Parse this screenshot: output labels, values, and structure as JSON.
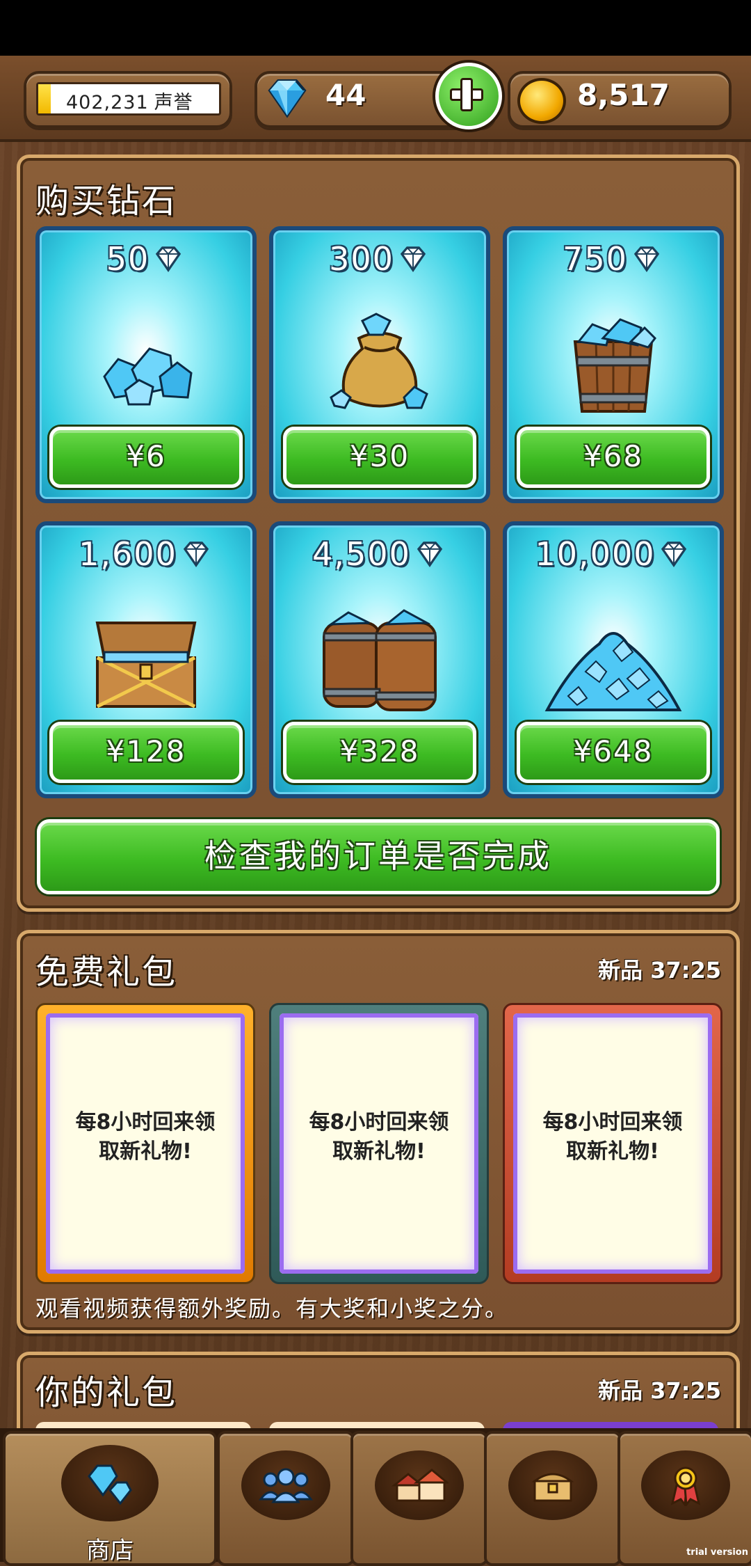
{
  "topbar": {
    "reputation": {
      "value": "402,231",
      "label": "声誉",
      "fill_fraction": 0.07
    },
    "gems": "44",
    "gold": "8,517"
  },
  "buy_gems": {
    "title": "购买钻石",
    "packs": [
      {
        "amount": "50",
        "price": "¥6",
        "art": "gem-pile-small"
      },
      {
        "amount": "300",
        "price": "¥30",
        "art": "gem-sack"
      },
      {
        "amount": "750",
        "price": "¥68",
        "art": "gem-bucket"
      },
      {
        "amount": "1,600",
        "price": "¥128",
        "art": "gem-chest"
      },
      {
        "amount": "4,500",
        "price": "¥328",
        "art": "gem-barrels"
      },
      {
        "amount": "10,000",
        "price": "¥648",
        "art": "gem-mountain"
      }
    ],
    "check_order_label": "检查我的订单是否完成"
  },
  "free_gifts": {
    "title": "免费礼包",
    "timer": "新品 37:25",
    "cards": [
      {
        "line1": "每8小时回来领",
        "line2": "取新礼物!",
        "frame_color": "#f0a020"
      },
      {
        "line1": "每8小时回来领",
        "line2": "取新礼物!",
        "frame_color": "#3f6c6a"
      },
      {
        "line1": "每8小时回来领",
        "line2": "取新礼物!",
        "frame_color": "#d04e32"
      }
    ],
    "note": "观看视频获得额外奖励。有大奖和小奖之分。"
  },
  "your_gifts": {
    "title": "你的礼包",
    "timer": "新品 37:25"
  },
  "bottom_nav": {
    "tabs": [
      {
        "icon": "gem-icon",
        "label": "商店",
        "active": true
      },
      {
        "icon": "people-icon",
        "label": "",
        "active": false
      },
      {
        "icon": "house-icon",
        "label": "",
        "active": false
      },
      {
        "icon": "chest-icon",
        "label": "",
        "active": false
      },
      {
        "icon": "medal-icon",
        "label": "",
        "active": false
      }
    ],
    "watermark": "trial version"
  },
  "colors": {
    "accent_green": "#3dbb22",
    "gem_blue": "#36cfe3",
    "wood": "#7a5030"
  }
}
